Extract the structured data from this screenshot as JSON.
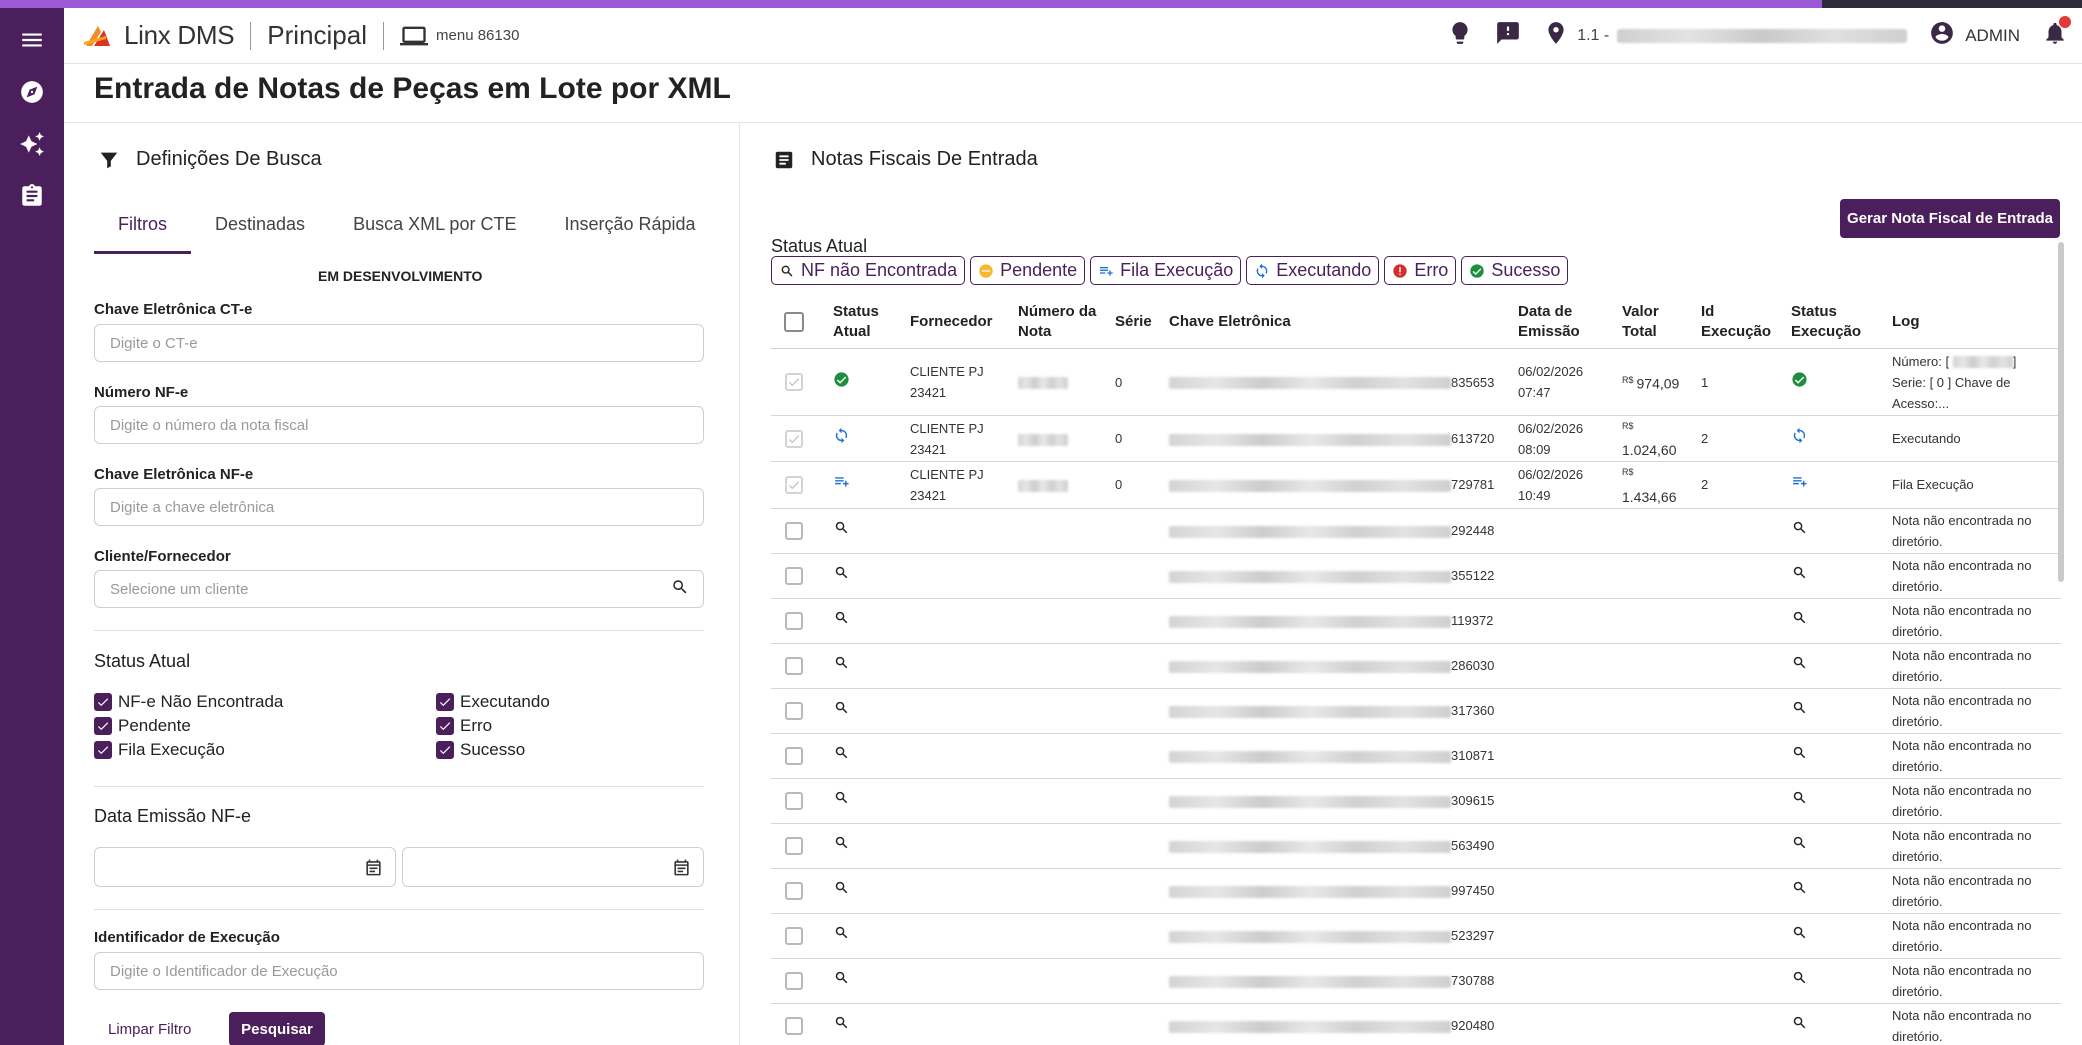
{
  "app": {
    "brand": "Linx DMS",
    "module": "Principal",
    "menu_label": "menu 86130",
    "location_prefix": "1.1 -",
    "user": "ADMIN"
  },
  "rail": [
    "menu-icon",
    "compass-icon",
    "sparkles-icon",
    "clipboard-icon"
  ],
  "page": {
    "title": "Entrada de Notas de Peças em Lote por XML"
  },
  "left": {
    "section_title": "Definições De Busca",
    "tabs": [
      "Filtros",
      "Destinadas",
      "Busca XML por CTE",
      "Inserção Rápida"
    ],
    "dev_note": "EM DESENVOLVIMENTO",
    "fields": {
      "cte_label": "Chave Eletrônica CT-e",
      "cte_placeholder": "Digite o CT-e",
      "nfe_num_label": "Número NF-e",
      "nfe_num_placeholder": "Digite o número da nota fiscal",
      "nfe_key_label": "Chave Eletrônica NF-e",
      "nfe_key_placeholder": "Digite a chave eletrônica",
      "client_label": "Cliente/Fornecedor",
      "client_placeholder": "Selecione um cliente",
      "exec_label": "Identificador de Execução",
      "exec_placeholder": "Digite o Identificador de Execução"
    },
    "status_title": "Status Atual",
    "status_checks": [
      "NF-e Não Encontrada",
      "Executando",
      "Pendente",
      "Erro",
      "Fila Execução",
      "Sucesso"
    ],
    "date_title": "Data Emissão NF-e",
    "clear_button": "Limpar Filtro",
    "search_button": "Pesquisar"
  },
  "right": {
    "section_title": "Notas Fiscais De Entrada",
    "generate_button": "Gerar Nota Fiscal de Entrada",
    "status_title": "Status Atual",
    "chips": [
      {
        "label": "NF não Encontrada",
        "icon": "search-person-icon"
      },
      {
        "label": "Pendente",
        "icon": "pending-dot-icon",
        "color": "#f5b82e"
      },
      {
        "label": "Fila Execução",
        "icon": "queue-icon"
      },
      {
        "label": "Executando",
        "icon": "sync-icon"
      },
      {
        "label": "Erro",
        "icon": "error-dot-icon",
        "color": "#d32f2f"
      },
      {
        "label": "Sucesso",
        "icon": "check-circle-icon",
        "color": "#1e8e3e"
      }
    ],
    "columns": [
      "Status Atual",
      "Fornecedor",
      "Número da Nota",
      "Série",
      "Chave Eletrônica",
      "Data de Emissão",
      "Valor Total",
      "Id Execução",
      "Status Execução",
      "Log"
    ],
    "rows": [
      {
        "status": "sucesso",
        "fornecedor_1": "CLIENTE PJ",
        "fornecedor_2": "23421",
        "serie": "0",
        "key_tail": "835653",
        "date": "06/02/2026",
        "time": "07:47",
        "currency": "R$",
        "value": "974,09",
        "id": "1",
        "log_1": "Número: [",
        "log_1b": "]",
        "log_2": "Serie: [ 0 ] Chave de",
        "log_3": "Acesso:..."
      },
      {
        "status": "executando",
        "fornecedor_1": "CLIENTE PJ",
        "fornecedor_2": "23421",
        "serie": "0",
        "key_tail": "613720",
        "date": "06/02/2026",
        "time": "08:09",
        "currency": "R$",
        "value": "1.024,60",
        "id": "2",
        "log": "Executando"
      },
      {
        "status": "fila",
        "fornecedor_1": "CLIENTE PJ",
        "fornecedor_2": "23421",
        "serie": "0",
        "key_tail": "729781",
        "date": "06/02/2026",
        "time": "10:49",
        "currency": "R$",
        "value": "1.434,66",
        "id": "2",
        "log": "Fila Execução"
      },
      {
        "status": "nf",
        "key_tail": "292448",
        "log_1": "Nota não encontrada no",
        "log_2": "diretório."
      },
      {
        "status": "nf",
        "key_tail": "355122",
        "log_1": "Nota não encontrada no",
        "log_2": "diretório."
      },
      {
        "status": "nf",
        "key_tail": "119372",
        "log_1": "Nota não encontrada no",
        "log_2": "diretório."
      },
      {
        "status": "nf",
        "key_tail": "286030",
        "log_1": "Nota não encontrada no",
        "log_2": "diretório."
      },
      {
        "status": "nf",
        "key_tail": "317360",
        "log_1": "Nota não encontrada no",
        "log_2": "diretório."
      },
      {
        "status": "nf",
        "key_tail": "310871",
        "log_1": "Nota não encontrada no",
        "log_2": "diretório."
      },
      {
        "status": "nf",
        "key_tail": "309615",
        "log_1": "Nota não encontrada no",
        "log_2": "diretório."
      },
      {
        "status": "nf",
        "key_tail": "563490",
        "log_1": "Nota não encontrada no",
        "log_2": "diretório."
      },
      {
        "status": "nf",
        "key_tail": "997450",
        "log_1": "Nota não encontrada no",
        "log_2": "diretório."
      },
      {
        "status": "nf",
        "key_tail": "523297",
        "log_1": "Nota não encontrada no",
        "log_2": "diretório."
      },
      {
        "status": "nf",
        "key_tail": "730788",
        "log_1": "Nota não encontrada no",
        "log_2": "diretório."
      },
      {
        "status": "nf",
        "key_tail": "920480",
        "log_1": "Nota não encontrada no",
        "log_2": "diretório."
      }
    ]
  },
  "colors": {
    "primary": "#4a1f5c",
    "success": "#1e8e3e",
    "info": "#1e6fd9",
    "pending": "#f5b82e",
    "error": "#d32f2f"
  }
}
